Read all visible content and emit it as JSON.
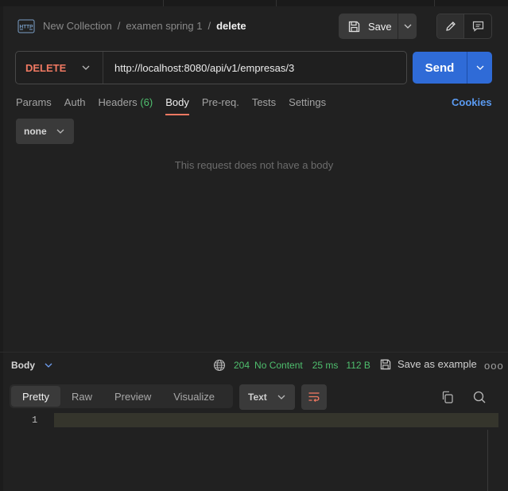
{
  "header": {
    "badge": "HTTP",
    "breadcrumbs": [
      "New Collection",
      "examen spring 1"
    ],
    "separator": "/",
    "current": "delete",
    "save_label": "Save"
  },
  "request": {
    "method": "DELETE",
    "url": "http://localhost:8080/api/v1/empresas/3",
    "send_label": "Send"
  },
  "tabs": {
    "params": "Params",
    "auth": "Auth",
    "headers": "Headers",
    "headers_count": "(6)",
    "body": "Body",
    "prereq": "Pre-req.",
    "tests": "Tests",
    "settings": "Settings",
    "cookies": "Cookies"
  },
  "body_type": "none",
  "no_body_text": "This request does not have a body",
  "response": {
    "body_tab": "Body",
    "status_code": "204",
    "status_text": "No Content",
    "time": "25 ms",
    "size": "112 B",
    "save_example": "Save as example",
    "more": "ooo",
    "view_tabs": [
      "Pretty",
      "Raw",
      "Preview",
      "Visualize"
    ],
    "active_view": "Pretty",
    "format": "Text",
    "line_number": "1"
  },
  "colors": {
    "method": "#f07962",
    "send": "#2f6bd7",
    "status": "#4fbf6e",
    "cookies": "#5b9bf2",
    "active_tab_underline": "#f07962"
  }
}
